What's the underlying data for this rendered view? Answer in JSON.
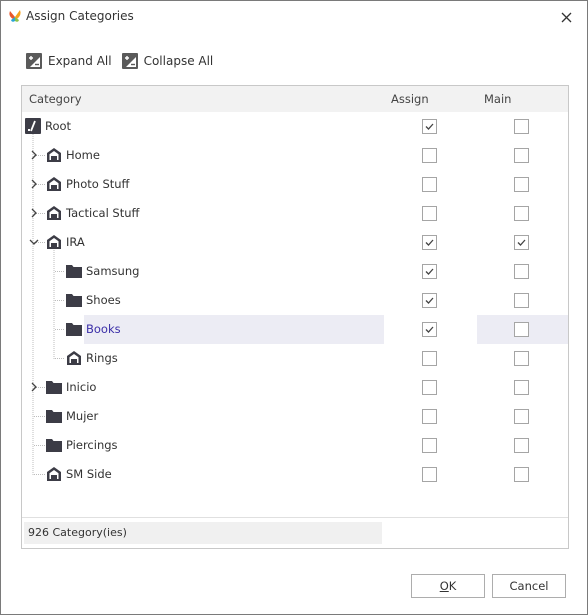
{
  "window": {
    "title": "Assign Categories",
    "app_icon": "butterfly-logo-icon",
    "close_icon": "close-icon"
  },
  "toolbar": {
    "expand_all_label": "Expand All",
    "collapse_all_label": "Collapse All"
  },
  "grid": {
    "columns": {
      "category": "Category",
      "assign": "Assign",
      "main": "Main"
    },
    "rows": [
      {
        "label": "Root",
        "level": 0,
        "icon": "root-icon",
        "expander": "none",
        "assign": true,
        "main": false,
        "selected": false
      },
      {
        "label": "Home",
        "level": 1,
        "icon": "home-icon",
        "expander": "collapsed",
        "assign": false,
        "main": false,
        "selected": false
      },
      {
        "label": "Photo Stuff",
        "level": 1,
        "icon": "home-icon",
        "expander": "collapsed",
        "assign": false,
        "main": false,
        "selected": false
      },
      {
        "label": "Tactical Stuff",
        "level": 1,
        "icon": "home-icon",
        "expander": "collapsed",
        "assign": false,
        "main": false,
        "selected": false
      },
      {
        "label": "IRA",
        "level": 1,
        "icon": "home-icon",
        "expander": "expanded",
        "assign": true,
        "main": true,
        "selected": false
      },
      {
        "label": "Samsung",
        "level": 2,
        "icon": "folder-icon",
        "expander": "none",
        "assign": true,
        "main": false,
        "selected": false
      },
      {
        "label": "Shoes",
        "level": 2,
        "icon": "folder-icon",
        "expander": "none",
        "assign": true,
        "main": false,
        "selected": false
      },
      {
        "label": "Books",
        "level": 2,
        "icon": "folder-icon",
        "expander": "none",
        "assign": true,
        "main": false,
        "selected": true
      },
      {
        "label": "Rings",
        "level": 2,
        "icon": "home-icon",
        "expander": "none",
        "assign": false,
        "main": false,
        "selected": false
      },
      {
        "label": "Inicio",
        "level": 1,
        "icon": "folder-icon",
        "expander": "collapsed",
        "assign": false,
        "main": false,
        "selected": false
      },
      {
        "label": "Mujer",
        "level": 1,
        "icon": "folder-icon",
        "expander": "none",
        "assign": false,
        "main": false,
        "selected": false
      },
      {
        "label": "Piercings",
        "level": 1,
        "icon": "folder-icon",
        "expander": "none",
        "assign": false,
        "main": false,
        "selected": false
      },
      {
        "label": "SM Side",
        "level": 1,
        "icon": "home-icon",
        "expander": "none",
        "assign": false,
        "main": false,
        "selected": false
      }
    ],
    "count_text": "926 Category(ies)"
  },
  "buttons": {
    "ok_label": "OK",
    "ok_mnemonic": "O",
    "ok_rest": "K",
    "cancel_label": "Cancel"
  },
  "colors": {
    "selected_text": "#3b2fa8",
    "selected_bg": "#ececf4",
    "icon_dark": "#3c3c46"
  }
}
